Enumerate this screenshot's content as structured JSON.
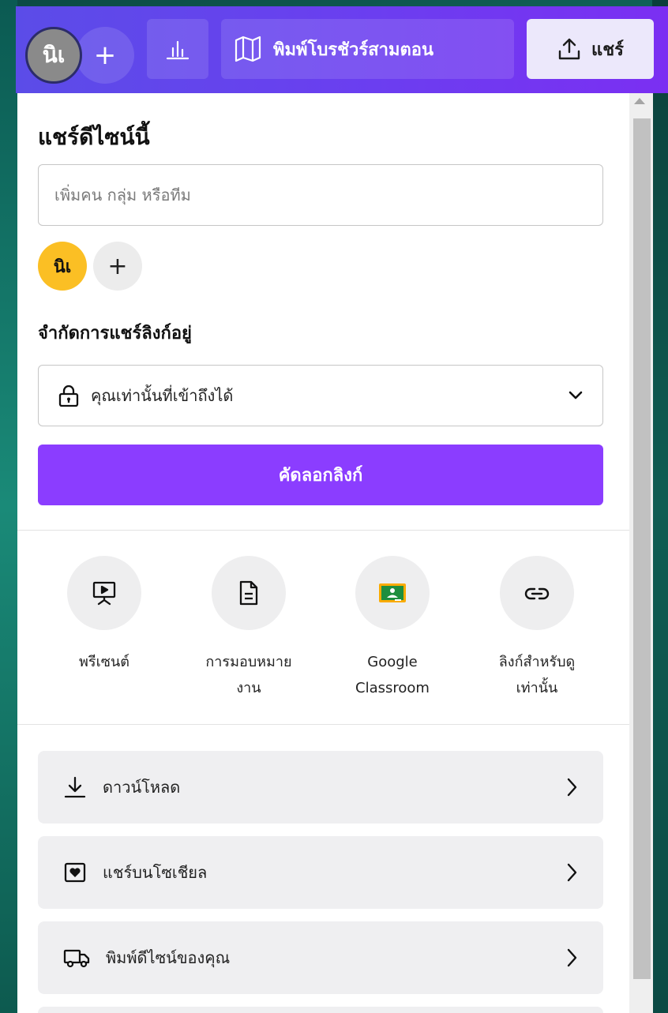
{
  "topbar": {
    "avatar_initials": "นิเ",
    "add_label": "+",
    "print_label": "พิมพ์โบรชัวร์สามตอน",
    "share_label": "แชร์"
  },
  "panel": {
    "title": "แชร์ดีไซน์นี้",
    "invite_placeholder": "เพิ่มคน กลุ่ม หรือทีม",
    "member_initials": "นิเ",
    "member_add": "+",
    "access_label": "จำกัดการแชร์ลิงก์อยู่",
    "access_value": "คุณเท่านั้นที่เข้าถึงได้",
    "copy_link": "คัดลอกลิงก์",
    "options": [
      {
        "label": "พรีเซนต์",
        "icon": "present-icon"
      },
      {
        "label": "การมอบหมาย\nงาน",
        "icon": "assignment-icon"
      },
      {
        "label": "Google\nClassroom",
        "icon": "google-classroom-icon"
      },
      {
        "label": "ลิงก์สำหรับดู\nเท่านั้น",
        "icon": "link-icon"
      }
    ],
    "rows": [
      {
        "label": "ดาวน์โหลด",
        "icon": "download-icon"
      },
      {
        "label": "แชร์บนโซเชียล",
        "icon": "social-heart-icon"
      },
      {
        "label": "พิมพ์ดีไซน์ของคุณ",
        "icon": "truck-icon"
      }
    ]
  },
  "colors": {
    "accent": "#8b3dff",
    "topbar_start": "#5b4ce8",
    "topbar_end": "#7b2ff2",
    "member_avatar": "#fbbf24",
    "classroom_green": "#1e8e3e"
  }
}
